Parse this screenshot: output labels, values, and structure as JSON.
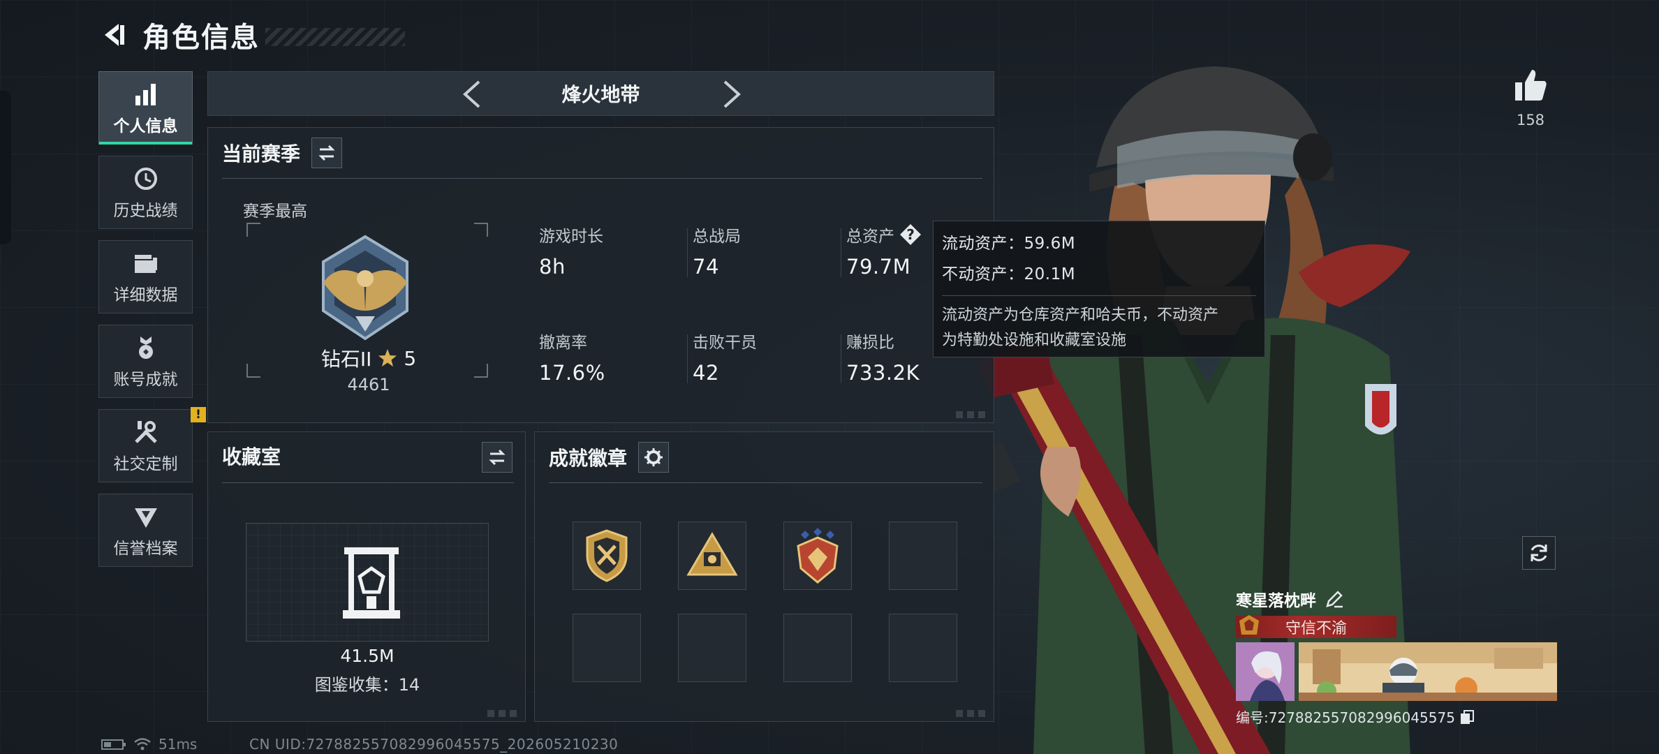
{
  "header": {
    "title": "角色信息"
  },
  "sidebar": {
    "items": [
      {
        "label": "个人信息",
        "icon": "bar-chart-icon",
        "active": true
      },
      {
        "label": "历史战绩",
        "icon": "history-clock-icon"
      },
      {
        "label": "详细数据",
        "icon": "folder-stack-icon"
      },
      {
        "label": "账号成就",
        "icon": "achievement-medal-icon"
      },
      {
        "label": "社交定制",
        "icon": "wrench-tools-icon",
        "badge": "!"
      },
      {
        "label": "信誉档案",
        "icon": "credit-shield-icon"
      }
    ]
  },
  "mode": {
    "title": "烽火地带"
  },
  "season": {
    "title": "当前赛季",
    "best_label": "赛季最高",
    "rank_name": "钻石II",
    "rank_stars": "5",
    "rank_score": "4461",
    "stats": [
      {
        "label": "游戏时长",
        "value": "8h"
      },
      {
        "label": "总战局",
        "value": "74"
      },
      {
        "label": "总资产",
        "value": "79.7M"
      },
      {
        "label": "撤离率",
        "value": "17.6%"
      },
      {
        "label": "击败干员",
        "value": "42"
      },
      {
        "label": "赚损比",
        "value": "733.2K"
      }
    ]
  },
  "tooltip": {
    "liquid": "流动资产：59.6M",
    "fixed": "不动资产：20.1M",
    "desc_line1": "流动资产为仓库资产和哈夫币，不动资产",
    "desc_line2": "为特勤处设施和收藏室设施"
  },
  "collection": {
    "title": "收藏室",
    "value": "41.5M",
    "count": "图鉴收集：14"
  },
  "badges": {
    "title": "成就徽章",
    "filled": 3,
    "slots": 8
  },
  "like": {
    "count": "158"
  },
  "profile": {
    "name": "寒星落枕畔",
    "title": "守信不渝",
    "id_label": "编号:727882557082996045575"
  },
  "status": {
    "ping": "51ms"
  },
  "footer": {
    "uid": "CN UID:727882557082996045575_202605210230"
  },
  "colors": {
    "accent": "#2fd6a5",
    "title_red": "#a52c2a",
    "badge_yellow": "#e2b11f"
  }
}
